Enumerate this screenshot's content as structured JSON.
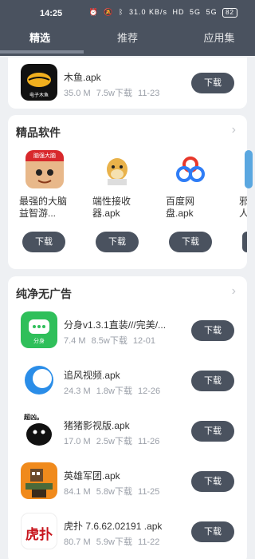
{
  "status_bar": {
    "time": "14:25",
    "icons": [
      "alarm-icon",
      "mute-icon",
      "bluetooth-icon",
      "wifi-icon",
      "hd-icon",
      "signal-icon",
      "signal-icon"
    ],
    "speed": "31.0 KB/s",
    "hd": "HD",
    "sig1": "5G",
    "sig2": "5G",
    "battery": "82"
  },
  "tabs": [
    {
      "label": "精选",
      "active": true
    },
    {
      "label": "推荐",
      "active": false
    },
    {
      "label": "应用集",
      "active": false
    }
  ],
  "top_app": {
    "name": "木鱼.apk",
    "size": "35.0 M",
    "downloads": "7.5w下载",
    "date": "11-23",
    "button": "下载",
    "icon_text": "电子木鱼"
  },
  "section_premium": {
    "title": "精品软件",
    "items": [
      {
        "name": "最强的大脑益智游...",
        "button": "下载",
        "icon_text": "脑强大脑"
      },
      {
        "name": "端性接收器.apk",
        "button": "下载"
      },
      {
        "name": "百度网盘.apk",
        "button": "下载"
      },
      {
        "name": "邪人",
        "button": "下载"
      }
    ]
  },
  "section_adfree": {
    "title": "纯净无广告",
    "items": [
      {
        "name": "分身v1.3.1直装///完美/...",
        "size": "7.4 M",
        "downloads": "8.5w下载",
        "date": "12-01",
        "button": "下载",
        "icon_text": "分身"
      },
      {
        "name": "追风视频.apk",
        "size": "24.3 M",
        "downloads": "1.8w下载",
        "date": "12-26",
        "button": "下载"
      },
      {
        "name": "猪猪影视版.apk",
        "size": "17.0 M",
        "downloads": "2.5w下载",
        "date": "11-26",
        "button": "下载",
        "icon_text": "超凶。"
      },
      {
        "name": "英雄军团.apk",
        "size": "84.1 M",
        "downloads": "5.8w下载",
        "date": "11-25",
        "button": "下载"
      },
      {
        "name": "虎扑 7.6.62.02191 .apk",
        "size": "80.7 M",
        "downloads": "5.9w下载",
        "date": "11-22",
        "button": "下载",
        "icon_text": "虎扑"
      }
    ]
  },
  "colors": {
    "header": "#4a525f",
    "button": "#4a525f",
    "background": "#eef0f3"
  }
}
